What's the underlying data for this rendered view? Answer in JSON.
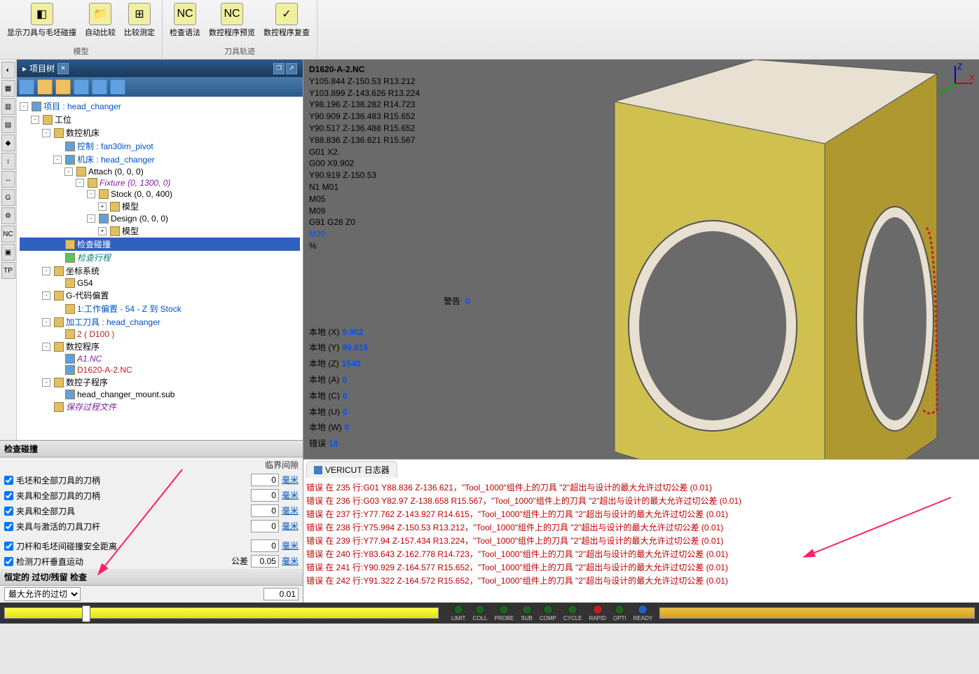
{
  "ribbon": {
    "groups": [
      {
        "label": "模型",
        "items": [
          {
            "label": "显示刀具与毛坯碰撞",
            "icon": "◧"
          },
          {
            "label": "自动比较",
            "icon": "📁"
          },
          {
            "label": "比较测定",
            "icon": "⊞"
          }
        ]
      },
      {
        "label": "刀具轨迹",
        "items": [
          {
            "label": "检查语法",
            "icon": "NC"
          },
          {
            "label": "数控程序预览",
            "icon": "NC"
          },
          {
            "label": "数控程序复查",
            "icon": "✓"
          }
        ]
      }
    ]
  },
  "tree": {
    "title": "项目树",
    "nodes": [
      {
        "indent": 0,
        "toggle": "-",
        "label": "项目 : head_changer",
        "cls": "blue",
        "icon": "blue"
      },
      {
        "indent": 1,
        "toggle": "-",
        "label": "工位",
        "icon": ""
      },
      {
        "indent": 2,
        "toggle": "-",
        "label": "数控机床",
        "icon": ""
      },
      {
        "indent": 3,
        "toggle": "",
        "label": "控制 : fan30im_pivot",
        "cls": "blue",
        "icon": "blue"
      },
      {
        "indent": 3,
        "toggle": "-",
        "label": "机床 : head_changer",
        "cls": "blue",
        "icon": "blue"
      },
      {
        "indent": 4,
        "toggle": "-",
        "label": "Attach (0, 0, 0)",
        "icon": ""
      },
      {
        "indent": 5,
        "toggle": "-",
        "label": "Fixture (0, 1300, 0)",
        "cls": "purple",
        "icon": ""
      },
      {
        "indent": 6,
        "toggle": "-",
        "label": "Stock (0, 0, 400)",
        "icon": ""
      },
      {
        "indent": 7,
        "toggle": "+",
        "label": "模型",
        "icon": ""
      },
      {
        "indent": 6,
        "toggle": "-",
        "label": "Design (0, 0, 0)",
        "icon": "blue"
      },
      {
        "indent": 7,
        "toggle": "+",
        "label": "模型",
        "icon": ""
      },
      {
        "indent": 3,
        "toggle": "",
        "label": "检查碰撞",
        "icon": "",
        "selected": true
      },
      {
        "indent": 3,
        "toggle": "",
        "label": "检查行程",
        "cls": "teal",
        "icon": "green"
      },
      {
        "indent": 2,
        "toggle": "-",
        "label": "坐标系统",
        "icon": ""
      },
      {
        "indent": 3,
        "toggle": "",
        "label": "G54",
        "icon": ""
      },
      {
        "indent": 2,
        "toggle": "-",
        "label": "G-代码偏置",
        "icon": ""
      },
      {
        "indent": 3,
        "toggle": "",
        "label": "1:工作偏置 - 54 - Z 到 Stock",
        "cls": "blue",
        "icon": ""
      },
      {
        "indent": 2,
        "toggle": "-",
        "label": "加工刀具 : head_changer",
        "cls": "blue",
        "icon": ""
      },
      {
        "indent": 3,
        "toggle": "",
        "label": "2 ( D100 )",
        "cls": "red",
        "icon": ""
      },
      {
        "indent": 2,
        "toggle": "-",
        "label": "数控程序",
        "icon": ""
      },
      {
        "indent": 3,
        "toggle": "",
        "label": "A1.NC",
        "cls": "purple",
        "icon": "blue"
      },
      {
        "indent": 3,
        "toggle": "",
        "label": "D1620-A-2.NC",
        "cls": "red",
        "icon": "blue"
      },
      {
        "indent": 2,
        "toggle": "-",
        "label": "数控子程序",
        "icon": ""
      },
      {
        "indent": 3,
        "toggle": "",
        "label": "head_changer_mount.sub",
        "icon": "blue"
      },
      {
        "indent": 2,
        "toggle": "",
        "label": "保存过程文件",
        "cls": "purple",
        "icon": ""
      }
    ]
  },
  "collision": {
    "title": "检查碰撞",
    "header": "临界间隙",
    "rows": [
      {
        "label": "毛坯和全部刀具的刀柄",
        "val": "0",
        "unit": "毫米"
      },
      {
        "label": "夹具和全部刀具的刀柄",
        "val": "0",
        "unit": "毫米"
      },
      {
        "label": "夹具和全部刀具",
        "val": "0",
        "unit": "毫米"
      },
      {
        "label": "夹具与激活的刀具刀杆",
        "val": "0",
        "unit": "毫米"
      }
    ],
    "rows2": [
      {
        "label": "刀杆和毛坯间碰撞安全距离",
        "val": "0",
        "unit": "毫米"
      },
      {
        "label": "检测刀杆垂直运动",
        "pre": "公差",
        "val": "0.05",
        "unit": "毫米"
      }
    ],
    "constant": {
      "title": "恒定的 过切/残留 检查",
      "select": "最大允许的过切",
      "val": "0.01"
    }
  },
  "nc": {
    "title": "D1620-A-2.NC",
    "lines": [
      "Y105.844 Z-150.53 R13.212",
      "Y103.899 Z-143.626 R13.224",
      "Y98.196 Z-138.282 R14.723",
      "Y90.909 Z-136.483 R15.652",
      "Y90.517 Z-136.488 R15.652",
      "Y88.836 Z-136.621 R15.567",
      "G01 X2.",
      "G00 X9.902",
      "Y90.919 Z-150.53",
      "N1 M01",
      "M05",
      "M09",
      "G91 G28 Z0"
    ],
    "end": "M30",
    "pct": "%"
  },
  "status": {
    "rows": [
      {
        "label": "本地 (X)",
        "val": "9.902"
      },
      {
        "label": "本地 (Y)",
        "val": "90.919"
      },
      {
        "label": "本地 (Z)",
        "val": "1540"
      },
      {
        "label": "本地 (A)",
        "val": "0"
      },
      {
        "label": "本地 (C)",
        "val": "0"
      },
      {
        "label": "本地 (U)",
        "val": "0"
      },
      {
        "label": "本地 (W)",
        "val": "0"
      },
      {
        "label": "错误",
        "val": "18"
      }
    ],
    "warn_label": "警告",
    "warn_val": "0"
  },
  "log": {
    "title": "VERICUT 日志器",
    "lines": [
      "错误 在 235 行:G01 Y88.836 Z-136.621，\"Tool_1000\"组件上的刀具 \"2\"超出与设计的最大允许过切公差 (0.01)",
      "错误 在 236 行:G03 Y82.97 Z-138.658 R15.567，\"Tool_1000\"组件上的刀具 \"2\"超出与设计的最大允许过切公差 (0.01)",
      "错误 在 237 行:Y77.762 Z-143.927 R14.615，\"Tool_1000\"组件上的刀具 \"2\"超出与设计的最大允许过切公差 (0.01)",
      "错误 在 238 行:Y75.994 Z-150.53 R13.212，\"Tool_1000\"组件上的刀具 \"2\"超出与设计的最大允许过切公差 (0.01)",
      "错误 在 239 行:Y77.94 Z-157.434 R13.224，\"Tool_1000\"组件上的刀具 \"2\"超出与设计的最大允许过切公差 (0.01)",
      "错误 在 240 行:Y83.643 Z-162.778 R14.723，\"Tool_1000\"组件上的刀具 \"2\"超出与设计的最大允许过切公差 (0.01)",
      "错误 在 241 行:Y90.929 Z-164.577 R15.652，\"Tool_1000\"组件上的刀具 \"2\"超出与设计的最大允许过切公差 (0.01)",
      "错误 在 242 行:Y91.322 Z-164.572 R15.652，\"Tool_1000\"组件上的刀具 \"2\"超出与设计的最大允许过切公差 (0.01)"
    ]
  },
  "leds": [
    {
      "label": "LIMIT",
      "color": "#206020"
    },
    {
      "label": "COLL",
      "color": "#206020"
    },
    {
      "label": "PROBE",
      "color": "#206020"
    },
    {
      "label": "SUB",
      "color": "#206020"
    },
    {
      "label": "COMP",
      "color": "#206020"
    },
    {
      "label": "CYCLE",
      "color": "#206020"
    },
    {
      "label": "RAPID",
      "color": "#c02020"
    },
    {
      "label": "OPTI",
      "color": "#206020"
    },
    {
      "label": "READY",
      "color": "#2060c0"
    }
  ]
}
